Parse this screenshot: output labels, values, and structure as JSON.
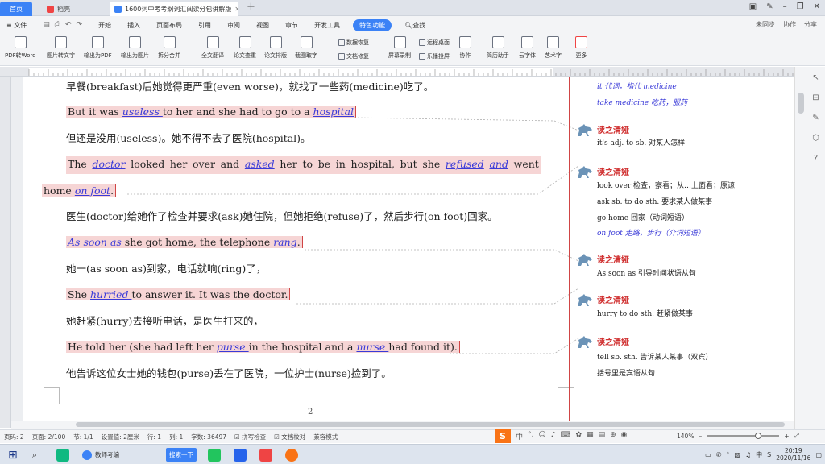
{
  "tabs": {
    "home": "首页",
    "docer": "稻壳",
    "doc": "1600词中考考纲词汇阅读分包讲解版"
  },
  "menu": {
    "file": "≡ 文件",
    "items": [
      "开始",
      "插入",
      "页面布局",
      "引用",
      "审阅",
      "视图",
      "章节",
      "开发工具"
    ],
    "special": "特色功能",
    "search": "查找",
    "right": [
      "未同步",
      "协作",
      "分享"
    ]
  },
  "ribbon": {
    "big": [
      "PDF转Word",
      "图片转文字",
      "输出为PDF",
      "输出为图片",
      "拆分合并",
      "全文翻译",
      "论文查重",
      "论文排版",
      "截图取字",
      "屏幕录制",
      "协作",
      "简历助手",
      "云字体",
      "艺术字",
      "更多"
    ],
    "small": [
      "数据恢复",
      "文档修复",
      "远程桌面",
      "乐播投屏"
    ]
  },
  "doc": {
    "zh1": "早餐(breakfast)后她觉得更严重(even worse)，就找了一些药(medicine)吃了。",
    "en1": {
      "a": "But it was ",
      "b": "useless ",
      "c": "to her and she had to go to a ",
      "d": "hospital"
    },
    "zh2": "但还是没用(useless)。她不得不去了医院(hospital)。",
    "en2a": [
      "The",
      "doctor",
      "looked",
      "her",
      "over",
      "and",
      "asked",
      "her",
      "to",
      "be",
      "in",
      "hospital,",
      "but",
      "she",
      "refused",
      "and",
      "went"
    ],
    "en2b": {
      "a": "home ",
      "b": "on foot",
      "c": "."
    },
    "zh3": "医生(doctor)给她作了检查并要求(ask)她住院，但她拒绝(refuse)了，然后步行(on foot)回家。",
    "en3": {
      "a": "As",
      "b": "soon",
      "c": "as",
      "d": " she got home, the telephone ",
      "e": "rang",
      "f": "."
    },
    "zh4": "她一(as soon as)到家，电话就响(ring)了，",
    "en4": {
      "a": "She ",
      "b": "hurried ",
      "c": "to answer it. It was the doctor."
    },
    "zh5": "她赶紧(hurry)去接听电话，是医生打来的，",
    "en5": {
      "a": "He told her (she had left her ",
      "b": "purse ",
      "c": "in the hospital and a ",
      "d": "nurse ",
      "e": "had found it)."
    },
    "zh6": "他告诉这位女士她的钱包(purse)丢在了医院，一位护士(nurse)捡到了。",
    "pagenum": "2"
  },
  "comments": {
    "top": [
      "it  代词，指代 medicine",
      "take medicine  吃药，服药"
    ],
    "title": "读之清娅",
    "c1": [
      "it's adj. to sb.  对某人怎样"
    ],
    "c2": [
      "look over  检查，察看；从…上面看；原谅",
      "ask sb. to do sth.  要求某人做某事",
      "go home  回家（动词短语）",
      "on foot  走路，步行（介词短语）"
    ],
    "c3": [
      "As soon as 引导时间状语从句"
    ],
    "c4": [
      "hurry to do sth.  赶紧做某事"
    ],
    "c5": [
      "tell sb. sth.  告诉某人某事（双宾）",
      "括号里是宾语从句"
    ]
  },
  "status": {
    "page": "页码: 2",
    "pages": "页面: 2/100",
    "section": "节: 1/1",
    "setting": "设置值: 2厘米",
    "row": "行: 1",
    "col": "列: 1",
    "words": "字数: 36497",
    "spell": "拼写检查",
    "proof": "文档校对",
    "compat": "兼容模式",
    "zoom": "140%"
  },
  "taskbar": {
    "app1": "教师考编",
    "app2": "搜索一下",
    "time": "20:19",
    "date": "2020/11/16"
  },
  "colors": {
    "accent": "#3b82f6",
    "highlight": "#f6d5d5",
    "comment_red": "#d03030",
    "word_blue": "#3a3ad8"
  }
}
